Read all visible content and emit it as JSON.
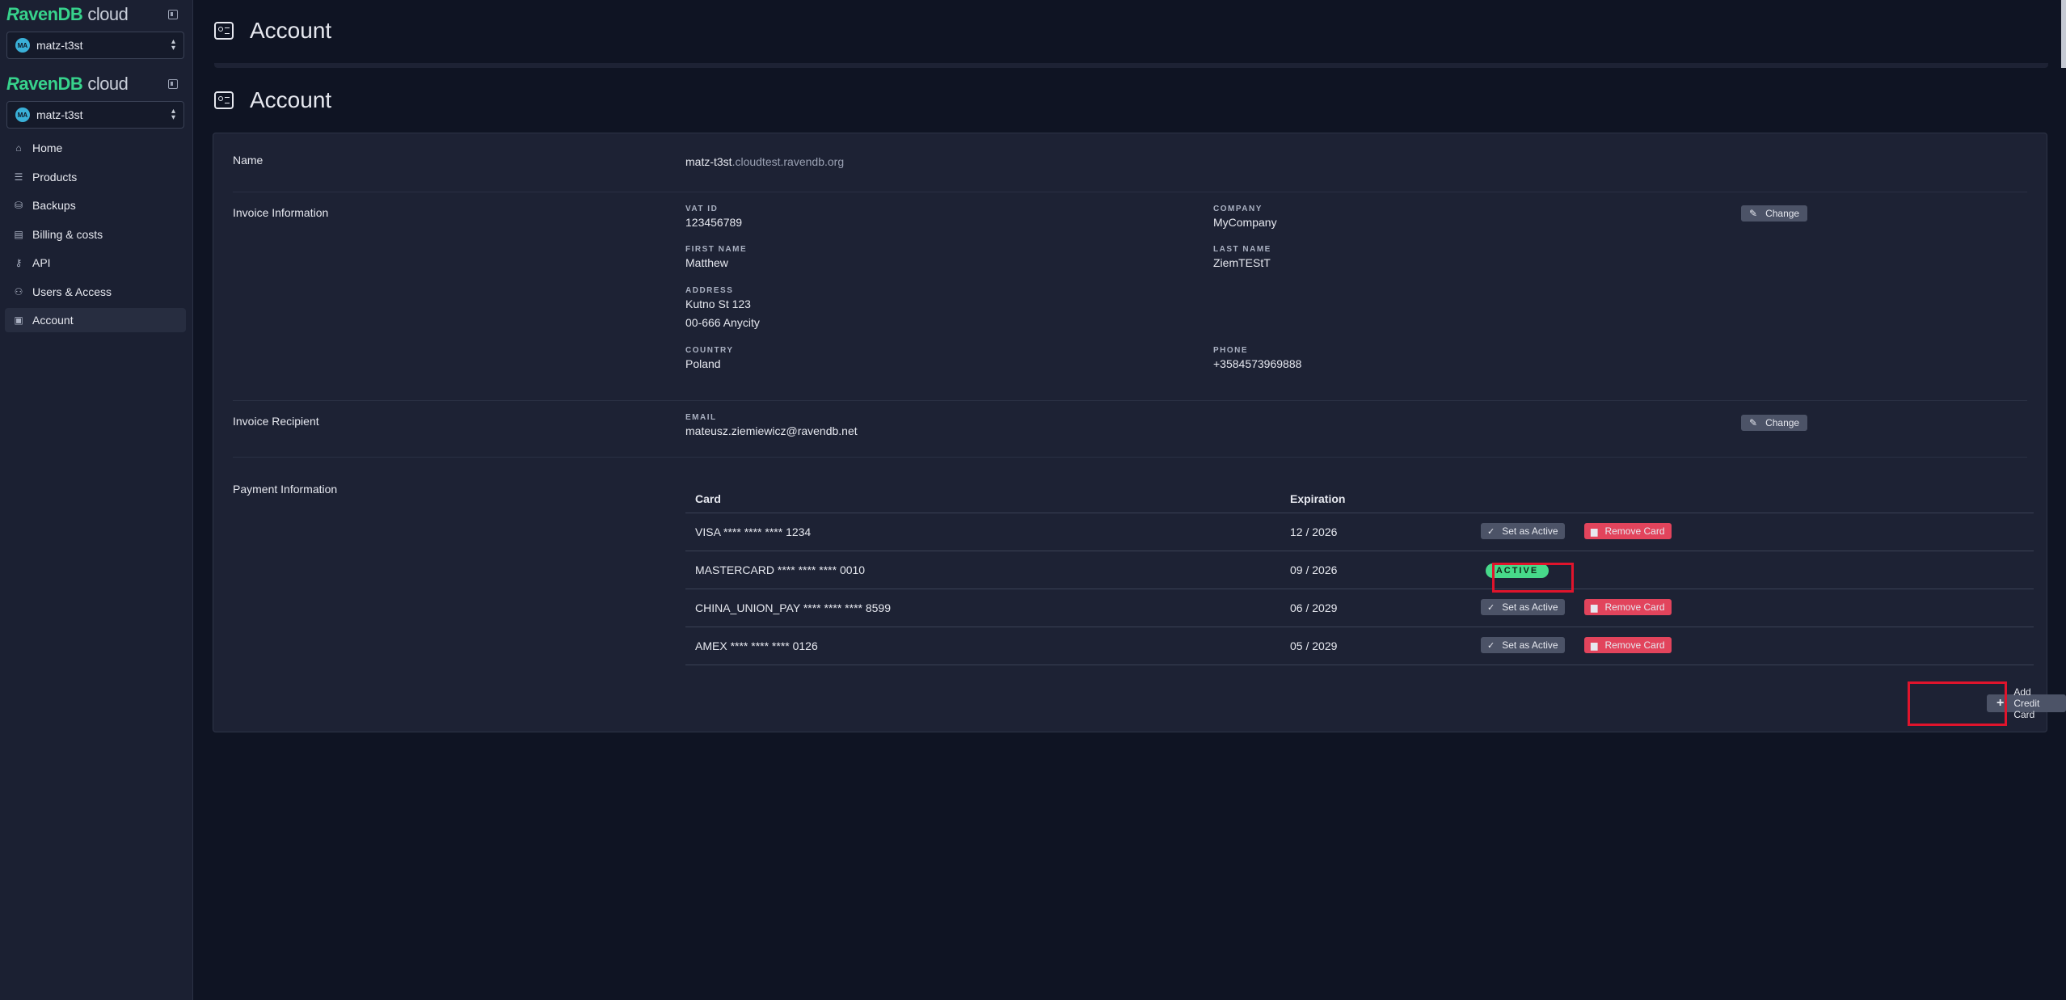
{
  "sidebar": {
    "brand_r": "R",
    "brand_db": "avenDB",
    "brand_cloud": "cloud",
    "org_initials": "MA",
    "org_name": "matz-t3st",
    "items": [
      {
        "label": "Home",
        "icon": "home-icon",
        "glyph": "⌂"
      },
      {
        "label": "Products",
        "icon": "database-icon",
        "glyph": "☰"
      },
      {
        "label": "Backups",
        "icon": "backup-icon",
        "glyph": "⛁"
      },
      {
        "label": "Billing & costs",
        "icon": "receipt-icon",
        "glyph": "▤"
      },
      {
        "label": "API",
        "icon": "key-icon",
        "glyph": "⚷"
      },
      {
        "label": "Users & Access",
        "icon": "users-icon",
        "glyph": "⚇"
      },
      {
        "label": "Account",
        "icon": "id-card-icon",
        "glyph": "▣"
      }
    ],
    "active_item": "Account"
  },
  "header": {
    "title": "Account"
  },
  "account": {
    "name_label": "Name",
    "name_main": "matz-t3st",
    "name_domain": ".cloudtest.ravendb.org",
    "invoice_info_label": "Invoice Information",
    "vat_label": "VAT ID",
    "vat": "123456789",
    "company_label": "COMPANY",
    "company": "MyCompany",
    "first_label": "FIRST NAME",
    "first": "Matthew",
    "last_label": "LAST NAME",
    "last": "ZiemTEStT",
    "address_label": "ADDRESS",
    "address1": "Kutno St 123",
    "address2": "00-666 Anycity",
    "country_label": "COUNTRY",
    "country": "Poland",
    "phone_label": "PHONE",
    "phone": "+3584573969888",
    "change_label": "Change",
    "recipient_label": "Invoice Recipient",
    "email_label": "EMAIL",
    "email": "mateusz.ziemiewicz@ravendb.net",
    "payment_label": "Payment Information"
  },
  "cards": {
    "col_card": "Card",
    "col_expiration": "Expiration",
    "set_active_label": "Set as Active",
    "remove_label": "Remove Card",
    "active_badge": "ACTIVE",
    "add_label": "Add Credit Card",
    "rows": [
      {
        "card": "VISA **** **** **** 1234",
        "exp": "12 / 2026",
        "active": false
      },
      {
        "card": "MASTERCARD **** **** **** 0010",
        "exp": "09 / 2026",
        "active": true
      },
      {
        "card": "CHINA_UNION_PAY **** **** **** 8599",
        "exp": "06 / 2029",
        "active": false
      },
      {
        "card": "AMEX **** **** **** 0126",
        "exp": "05 / 2029",
        "active": false
      }
    ]
  },
  "colors": {
    "accent": "#37d28c",
    "danger": "#e2445c",
    "highlight": "#e0142c",
    "active": "#47d98a"
  }
}
